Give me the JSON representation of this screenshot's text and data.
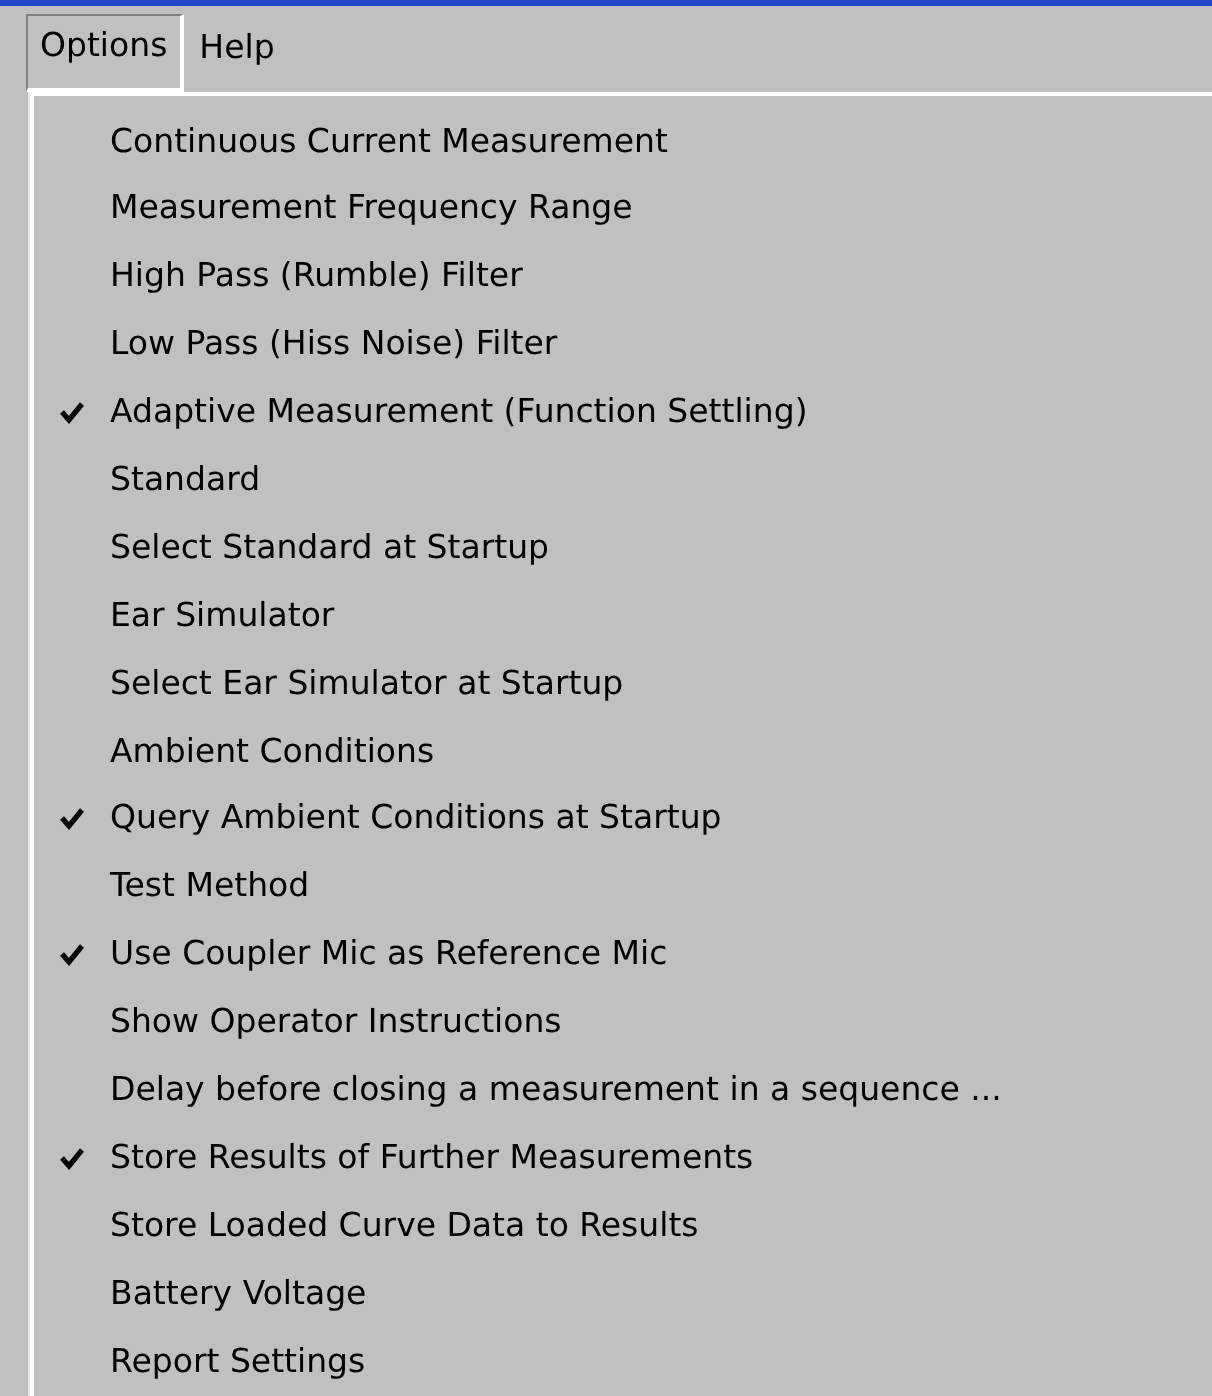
{
  "menu_bar": [
    {
      "label": "Options",
      "selected": true
    },
    {
      "label": "Help",
      "selected": false
    }
  ],
  "options_menu": [
    {
      "label": "Continuous Current Measurement",
      "checked": false
    },
    {
      "label": "Measurement Frequency Range",
      "checked": false
    },
    {
      "label": "High Pass (Rumble) Filter",
      "checked": false
    },
    {
      "label": "Low Pass (Hiss Noise) Filter",
      "checked": false
    },
    {
      "label": "Adaptive Measurement (Function Settling)",
      "checked": true
    },
    {
      "label": "Standard",
      "checked": false
    },
    {
      "label": "Select Standard at Startup",
      "checked": false
    },
    {
      "label": "Ear Simulator",
      "checked": false
    },
    {
      "label": "Select Ear Simulator at Startup",
      "checked": false
    },
    {
      "label": "Ambient Conditions",
      "checked": false
    },
    {
      "label": "Query Ambient Conditions at Startup",
      "checked": true
    },
    {
      "label": "Test Method",
      "checked": false
    },
    {
      "label": "Use Coupler Mic as Reference Mic",
      "checked": true
    },
    {
      "label": "Show Operator Instructions",
      "checked": false
    },
    {
      "label": "Delay before closing a measurement in a sequence ...",
      "checked": false
    },
    {
      "label": "Store Results of Further Measurements",
      "checked": true
    },
    {
      "label": "Store Loaded Curve Data to Results",
      "checked": false
    },
    {
      "label": "Battery Voltage",
      "checked": false
    },
    {
      "label": "Report Settings",
      "checked": false
    }
  ]
}
